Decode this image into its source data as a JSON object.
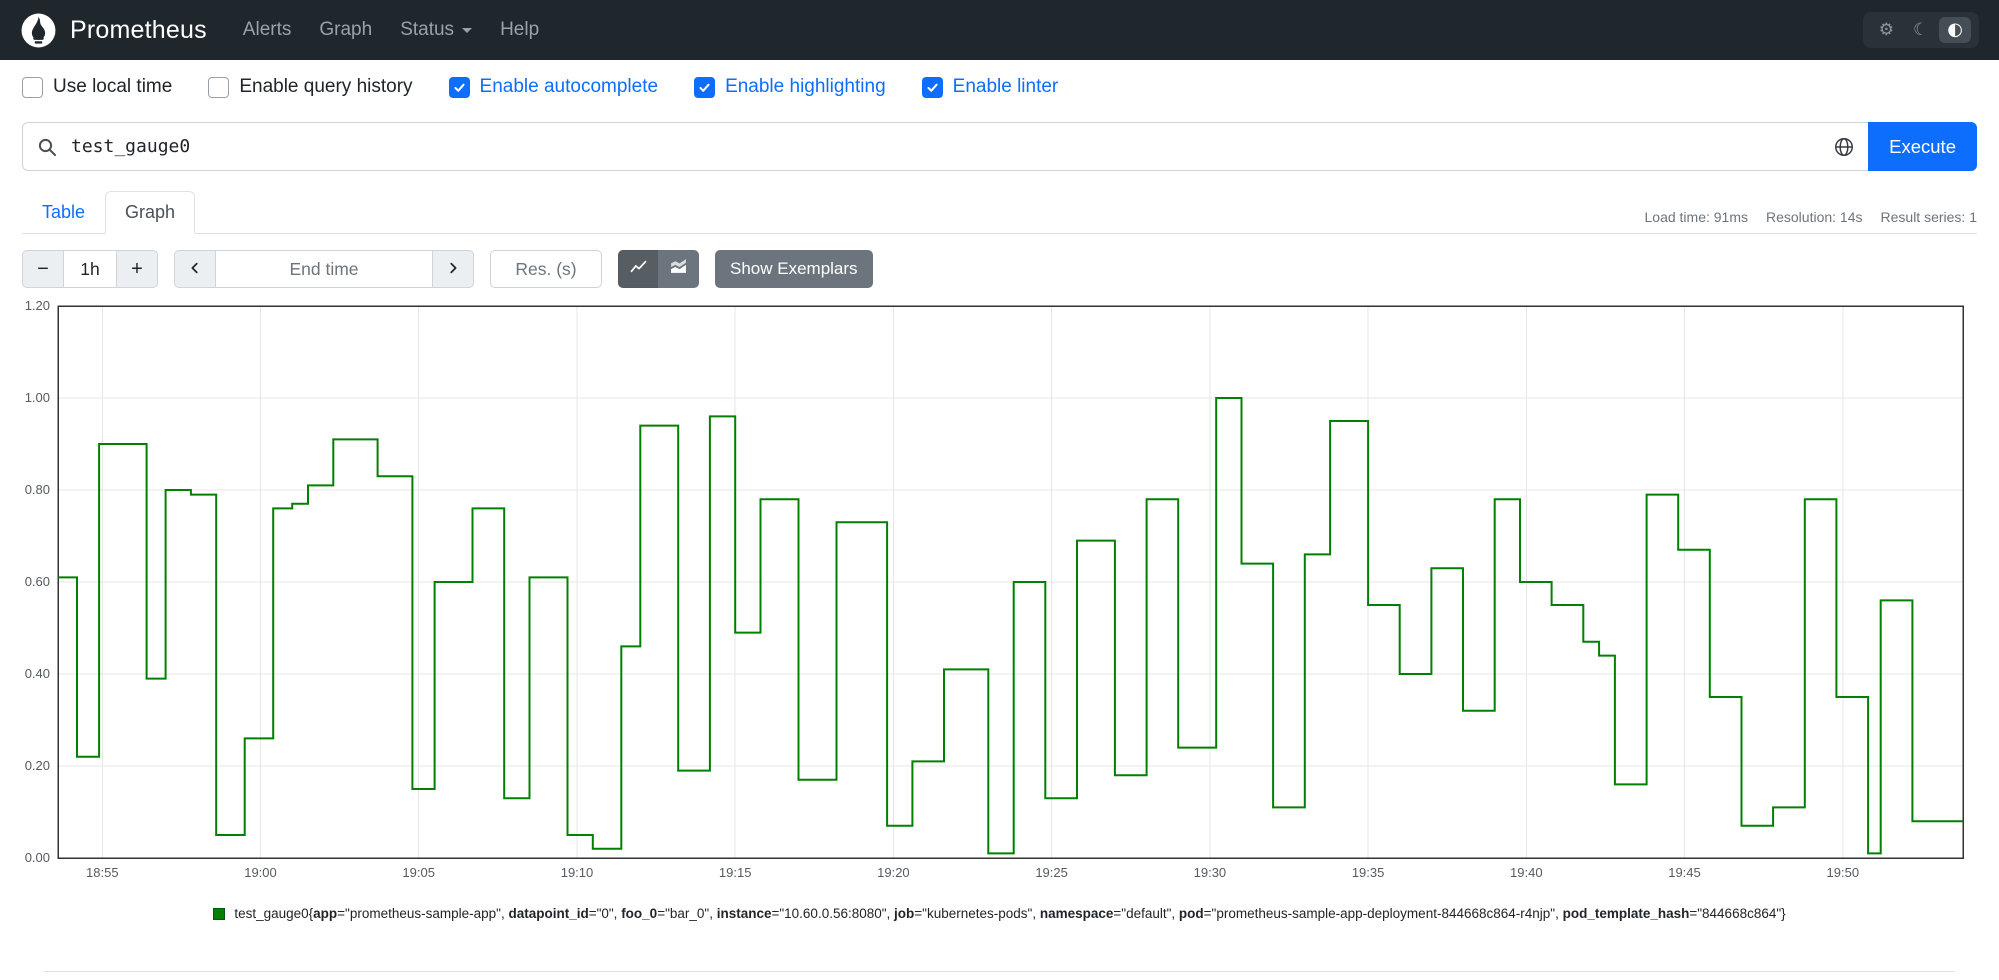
{
  "navbar": {
    "brand": "Prometheus",
    "items": [
      {
        "label": "Alerts"
      },
      {
        "label": "Graph"
      },
      {
        "label": "Status",
        "has_dropdown": true
      },
      {
        "label": "Help"
      }
    ],
    "theme_icons": {
      "settings": "⚙",
      "moon": "☾",
      "contrast": "◐"
    }
  },
  "options": {
    "checkboxes": [
      {
        "label": "Use local time",
        "checked": false
      },
      {
        "label": "Enable query history",
        "checked": false
      },
      {
        "label": "Enable autocomplete",
        "checked": true
      },
      {
        "label": "Enable highlighting",
        "checked": true
      },
      {
        "label": "Enable linter",
        "checked": true
      }
    ]
  },
  "query": {
    "value": "test_gauge0",
    "execute_label": "Execute"
  },
  "tabs": [
    {
      "label": "Table",
      "active": false
    },
    {
      "label": "Graph",
      "active": true
    }
  ],
  "stats": {
    "load_time": "Load time: 91ms",
    "resolution": "Resolution: 14s",
    "result_series": "Result series: 1"
  },
  "controls": {
    "range_minus": "−",
    "range_value": "1h",
    "range_plus": "+",
    "end_time_placeholder": "End time",
    "res_placeholder": "Res. (s)",
    "show_exemplars": "Show Exemplars"
  },
  "colors": {
    "accent_blue": "#0d6efd",
    "navbar_bg": "#1f262c",
    "secondary_button": "#6c757d",
    "series_green": "#008000"
  },
  "chart_data": {
    "type": "line",
    "subtype": "step-after",
    "title": "",
    "xlabel": "",
    "ylabel": "",
    "grid": true,
    "x_axis": {
      "unit": "minutes after 18:50",
      "domain": [
        3.6,
        63.8
      ],
      "ticks": [
        {
          "t": 5,
          "label": "18:55"
        },
        {
          "t": 10,
          "label": "19:00"
        },
        {
          "t": 15,
          "label": "19:05"
        },
        {
          "t": 20,
          "label": "19:10"
        },
        {
          "t": 25,
          "label": "19:15"
        },
        {
          "t": 30,
          "label": "19:20"
        },
        {
          "t": 35,
          "label": "19:25"
        },
        {
          "t": 40,
          "label": "19:30"
        },
        {
          "t": 45,
          "label": "19:35"
        },
        {
          "t": 50,
          "label": "19:40"
        },
        {
          "t": 55,
          "label": "19:45"
        },
        {
          "t": 60,
          "label": "19:50"
        }
      ]
    },
    "y_axis": {
      "domain": [
        0,
        1.2
      ],
      "ticks": [
        0,
        0.2,
        0.4,
        0.6,
        0.8,
        1.0,
        1.2
      ]
    },
    "series": [
      {
        "metric": "test_gauge0",
        "color": "#008000",
        "labels": [
          {
            "name": "app",
            "value": "prometheus-sample-app"
          },
          {
            "name": "datapoint_id",
            "value": "0"
          },
          {
            "name": "foo_0",
            "value": "bar_0"
          },
          {
            "name": "instance",
            "value": "10.60.0.56:8080"
          },
          {
            "name": "job",
            "value": "kubernetes-pods"
          },
          {
            "name": "namespace",
            "value": "default"
          },
          {
            "name": "pod",
            "value": "prometheus-sample-app-deployment-844668c864-r4njp"
          },
          {
            "name": "pod_template_hash",
            "value": "844668c864"
          }
        ],
        "points": [
          [
            3.6,
            0.61
          ],
          [
            4.2,
            0.22
          ],
          [
            4.9,
            0.9
          ],
          [
            6.4,
            0.39
          ],
          [
            7.0,
            0.8
          ],
          [
            7.8,
            0.79
          ],
          [
            8.6,
            0.05
          ],
          [
            9.5,
            0.26
          ],
          [
            10.4,
            0.76
          ],
          [
            11.0,
            0.77
          ],
          [
            11.5,
            0.81
          ],
          [
            12.3,
            0.91
          ],
          [
            13.7,
            0.83
          ],
          [
            14.8,
            0.15
          ],
          [
            15.5,
            0.6
          ],
          [
            16.7,
            0.76
          ],
          [
            17.7,
            0.13
          ],
          [
            18.5,
            0.61
          ],
          [
            19.7,
            0.05
          ],
          [
            20.5,
            0.02
          ],
          [
            21.4,
            0.46
          ],
          [
            22.0,
            0.94
          ],
          [
            23.2,
            0.19
          ],
          [
            24.2,
            0.96
          ],
          [
            25.0,
            0.49
          ],
          [
            25.8,
            0.78
          ],
          [
            27.0,
            0.17
          ],
          [
            28.2,
            0.73
          ],
          [
            29.8,
            0.07
          ],
          [
            30.6,
            0.21
          ],
          [
            31.6,
            0.41
          ],
          [
            33.0,
            0.01
          ],
          [
            33.8,
            0.6
          ],
          [
            34.8,
            0.13
          ],
          [
            35.8,
            0.69
          ],
          [
            37.0,
            0.18
          ],
          [
            38.0,
            0.78
          ],
          [
            39.0,
            0.24
          ],
          [
            40.2,
            1.0
          ],
          [
            41.0,
            0.64
          ],
          [
            42.0,
            0.11
          ],
          [
            43.0,
            0.66
          ],
          [
            43.8,
            0.95
          ],
          [
            45.0,
            0.55
          ],
          [
            46.0,
            0.4
          ],
          [
            47.0,
            0.63
          ],
          [
            48.0,
            0.32
          ],
          [
            49.0,
            0.78
          ],
          [
            49.8,
            0.6
          ],
          [
            50.8,
            0.55
          ],
          [
            51.8,
            0.47
          ],
          [
            52.3,
            0.44
          ],
          [
            52.8,
            0.16
          ],
          [
            53.8,
            0.79
          ],
          [
            54.8,
            0.67
          ],
          [
            55.8,
            0.35
          ],
          [
            56.8,
            0.07
          ],
          [
            57.8,
            0.11
          ],
          [
            58.8,
            0.78
          ],
          [
            59.8,
            0.35
          ],
          [
            60.8,
            0.01
          ],
          [
            61.2,
            0.56
          ],
          [
            62.2,
            0.08
          ],
          [
            63.8,
            0.08
          ]
        ]
      }
    ]
  }
}
